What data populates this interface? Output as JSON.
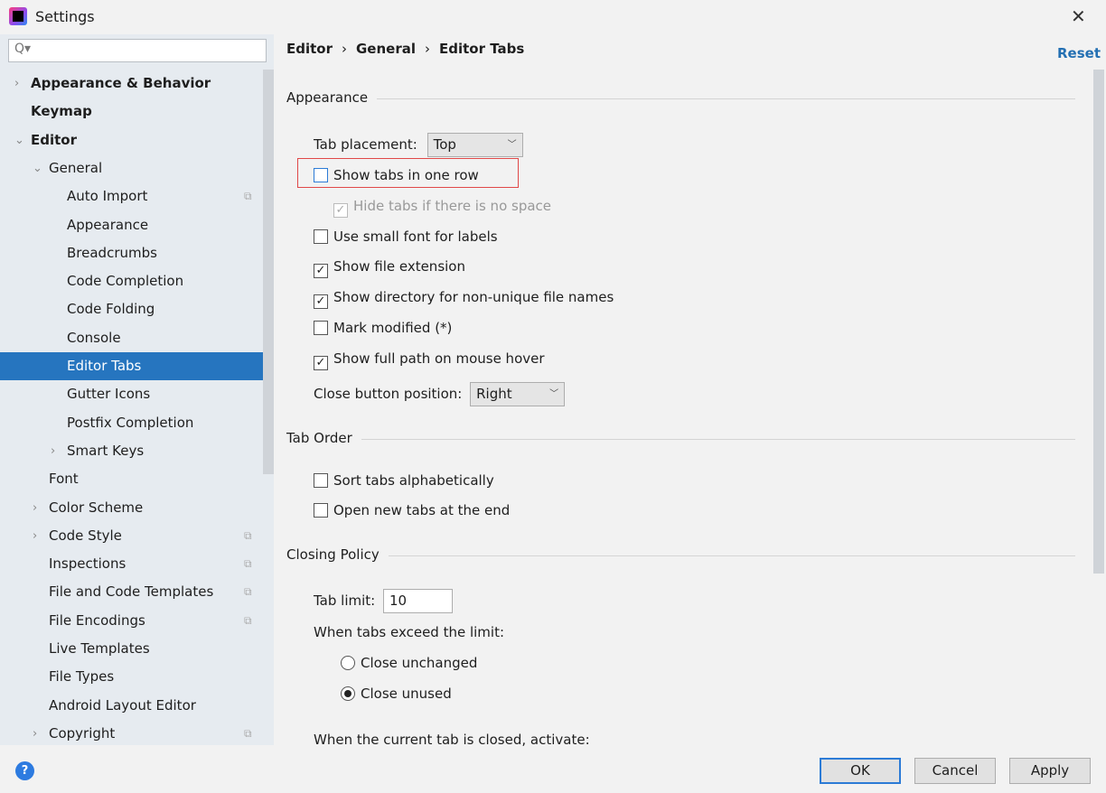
{
  "window": {
    "title": "Settings",
    "close": "✕"
  },
  "search": {
    "icon": "search-icon",
    "glyph": "Q▾",
    "value": ""
  },
  "tree": [
    {
      "label": "Appearance & Behavior",
      "level": 0,
      "arrow": "›",
      "bold": true
    },
    {
      "label": "Keymap",
      "level": 0,
      "bold": true
    },
    {
      "label": "Editor",
      "level": 0,
      "arrow": "⌄",
      "bold": true
    },
    {
      "label": "General",
      "level": 1,
      "arrow": "⌄"
    },
    {
      "label": "Auto Import",
      "level": 2,
      "proj": true
    },
    {
      "label": "Appearance",
      "level": 2
    },
    {
      "label": "Breadcrumbs",
      "level": 2
    },
    {
      "label": "Code Completion",
      "level": 2
    },
    {
      "label": "Code Folding",
      "level": 2
    },
    {
      "label": "Console",
      "level": 2
    },
    {
      "label": "Editor Tabs",
      "level": 2,
      "selected": true
    },
    {
      "label": "Gutter Icons",
      "level": 2
    },
    {
      "label": "Postfix Completion",
      "level": 2
    },
    {
      "label": "Smart Keys",
      "level": 2,
      "arrow": "›"
    },
    {
      "label": "Font",
      "level": 1
    },
    {
      "label": "Color Scheme",
      "level": 1,
      "arrow": "›"
    },
    {
      "label": "Code Style",
      "level": 1,
      "arrow": "›",
      "proj": true
    },
    {
      "label": "Inspections",
      "level": 1,
      "proj": true
    },
    {
      "label": "File and Code Templates",
      "level": 1,
      "proj": true
    },
    {
      "label": "File Encodings",
      "level": 1,
      "proj": true
    },
    {
      "label": "Live Templates",
      "level": 1
    },
    {
      "label": "File Types",
      "level": 1
    },
    {
      "label": "Android Layout Editor",
      "level": 1
    },
    {
      "label": "Copyright",
      "level": 1,
      "arrow": "›",
      "proj": true
    }
  ],
  "breadcrumb": [
    "Editor",
    "General",
    "Editor Tabs"
  ],
  "breadcrumb_sep": "›",
  "reset": "Reset",
  "appearance": {
    "header": "Appearance",
    "tab_placement_label": "Tab placement:",
    "tab_placement": "Top",
    "show_one_row": {
      "label": "Show tabs in one row",
      "checked": false
    },
    "hide_tabs": {
      "label": "Hide tabs if there is no space",
      "checked": true,
      "disabled": true
    },
    "small_font": {
      "label": "Use small font for labels",
      "checked": false
    },
    "file_ext": {
      "label": "Show file extension",
      "checked": true
    },
    "directory": {
      "label": "Show directory for non-unique file names",
      "checked": true
    },
    "mark_modified": {
      "label": "Mark modified (*)",
      "checked": false
    },
    "full_path": {
      "label": "Show full path on mouse hover",
      "checked": true
    },
    "close_pos_label": "Close button position:",
    "close_pos": "Right"
  },
  "tab_order": {
    "header": "Tab Order",
    "sort": {
      "label": "Sort tabs alphabetically",
      "checked": false
    },
    "open_end": {
      "label": "Open new tabs at the end",
      "checked": false
    }
  },
  "closing": {
    "header": "Closing Policy",
    "tab_limit_label": "Tab limit:",
    "tab_limit": "10",
    "exceed_label": "When tabs exceed the limit:",
    "close_unchanged": "Close unchanged",
    "close_unused": "Close unused",
    "selected": "Close unused",
    "activate_label": "When the current tab is closed, activate:"
  },
  "footer": {
    "help": "?",
    "ok": "OK",
    "cancel": "Cancel",
    "apply": "Apply"
  },
  "colors": {
    "accent": "#2675bf",
    "link": "#2470b3",
    "highlight": "#e04848"
  }
}
